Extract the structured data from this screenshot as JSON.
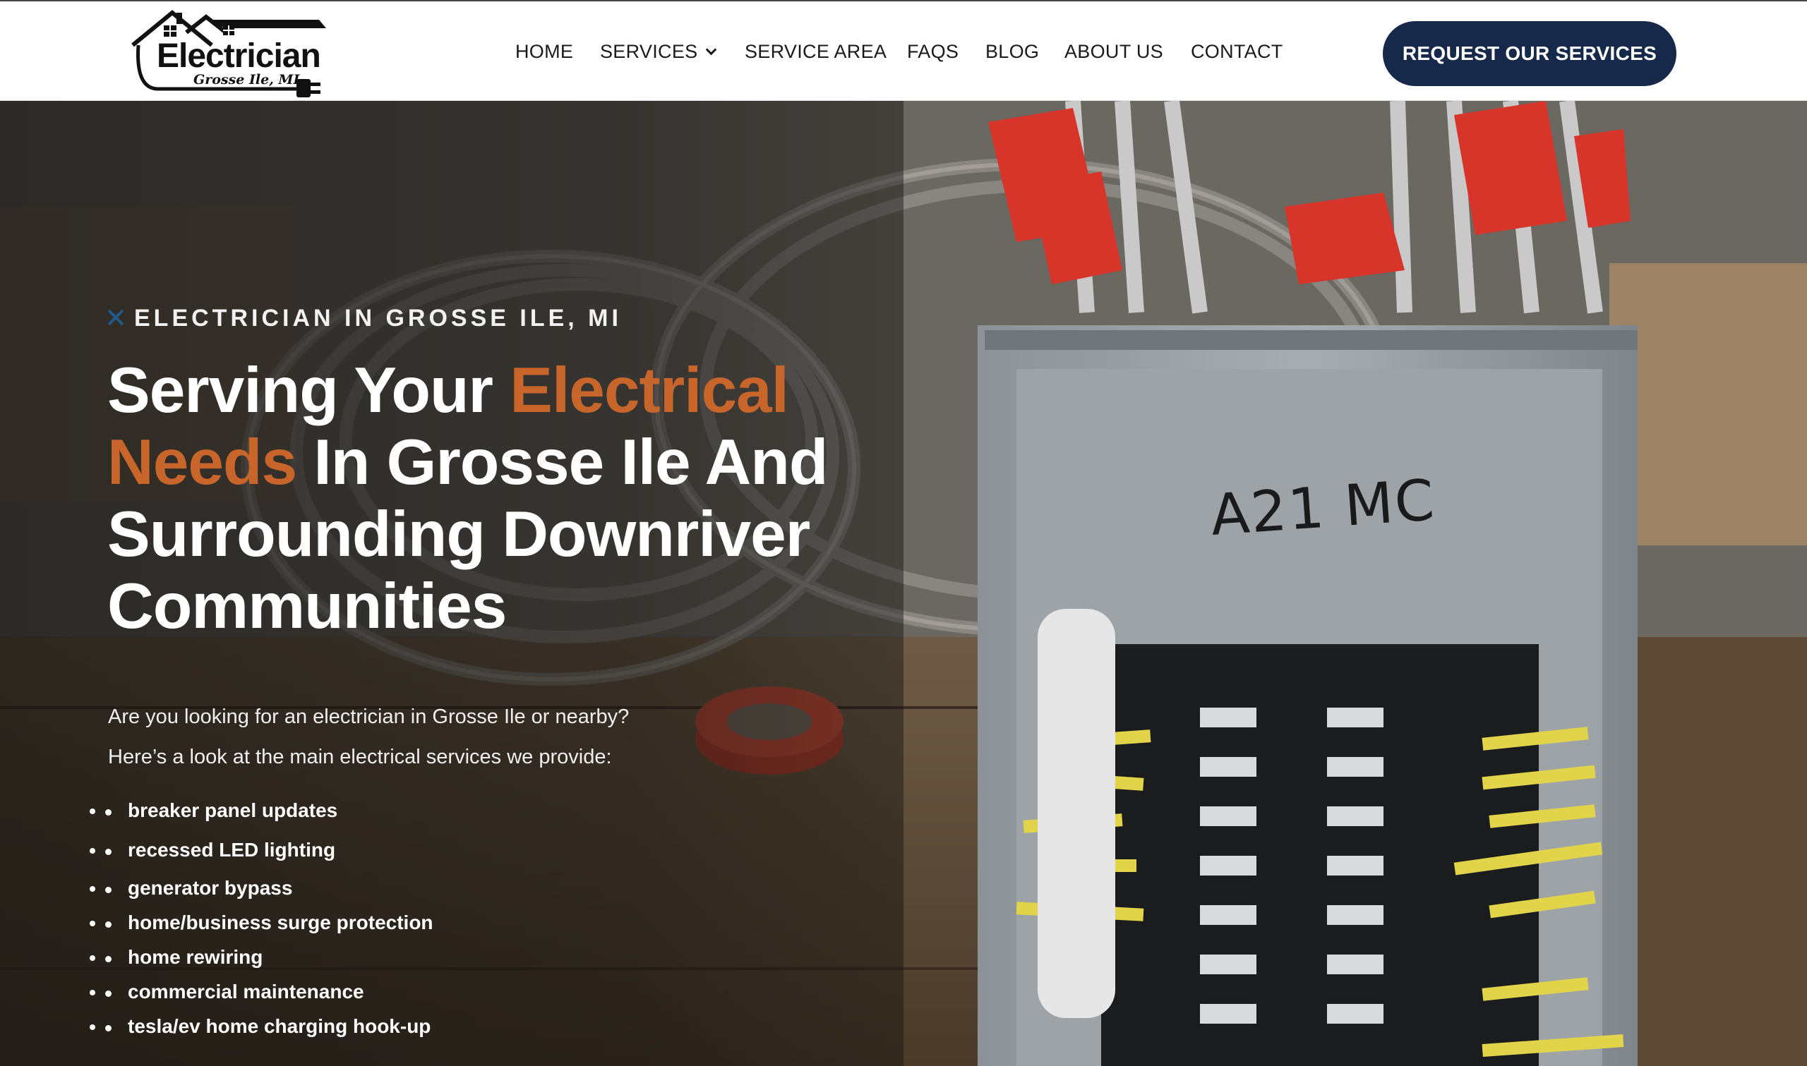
{
  "header": {
    "logo": {
      "title": "Electrician",
      "subtitle": "Grosse Ile, MI"
    },
    "nav": [
      {
        "label": "HOME",
        "has_dropdown": false
      },
      {
        "label": "SERVICES",
        "has_dropdown": true
      },
      {
        "label": "SERVICE AREA",
        "has_dropdown": false
      },
      {
        "label": "FAQS",
        "has_dropdown": false
      },
      {
        "label": "BLOG",
        "has_dropdown": false
      },
      {
        "label": "ABOUT US",
        "has_dropdown": false
      },
      {
        "label": "CONTACT",
        "has_dropdown": false
      }
    ],
    "cta_label": "REQUEST OUR SERVICES"
  },
  "hero": {
    "eyebrow": "ELECTRICIAN IN GROSSE ILE, MI",
    "headline_parts": {
      "part1": "Serving Your ",
      "accent1": "Electrical",
      "accent2": "Needs",
      "part2": " In Grosse Ile And Surrounding Downriver Communities"
    },
    "intro_line1": "Are you looking for an electrician in Grosse Ile or nearby?",
    "intro_line2": "Here’s a look at the main electrical services we provide:",
    "services": [
      "breaker panel updates",
      "recessed LED lighting",
      "generator bypass",
      "home/business surge protection",
      "home rewiring",
      "commercial maintenance",
      "tesla/ev home charging hook-up"
    ],
    "photo_panel_label": "A21 MC"
  },
  "colors": {
    "accent": "#c8652a",
    "cta_background": "#16294a",
    "nav_text": "#1a1a1a"
  },
  "icons": {
    "eyebrow": "tools-icon",
    "nav_dropdown": "chevron-down-icon",
    "logo": "house-plug-icon"
  }
}
